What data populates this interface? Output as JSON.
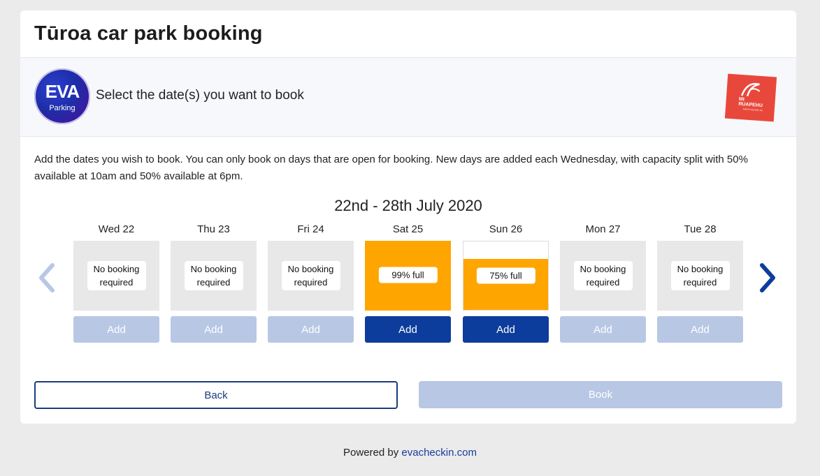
{
  "header": {
    "title": "Tūroa car park booking"
  },
  "select_band": {
    "logo_word": "EVA",
    "logo_sub": "Parking",
    "prompt": "Select the date(s) you want to book",
    "partner_logo_text_top": "Mt",
    "partner_logo_text_main": "RUAPEHU",
    "partner_logo_text_small": "NORTH ISLAND, NZ"
  },
  "intro": "Add the dates you wish to book. You can only book on days that are open for booking. New days are added each Wednesday, with capacity split with 50% available at 10am and 50% available at 6pm.",
  "week": {
    "label": "22nd - 28th July 2020",
    "prev_icon": "chevron-left-icon",
    "next_icon": "chevron-right-icon",
    "days": [
      {
        "name": "Wed 22",
        "status": "No booking required",
        "fill": 0,
        "add_label": "Add",
        "add_enabled": false
      },
      {
        "name": "Thu 23",
        "status": "No booking required",
        "fill": 0,
        "add_label": "Add",
        "add_enabled": false
      },
      {
        "name": "Fri 24",
        "status": "No booking required",
        "fill": 0,
        "add_label": "Add",
        "add_enabled": false
      },
      {
        "name": "Sat 25",
        "status": "99% full",
        "fill": 0.99,
        "add_label": "Add",
        "add_enabled": true
      },
      {
        "name": "Sun 26",
        "status": "75% full",
        "fill": 0.75,
        "add_label": "Add",
        "add_enabled": true
      },
      {
        "name": "Mon 27",
        "status": "No booking required",
        "fill": 0,
        "add_label": "Add",
        "add_enabled": false
      },
      {
        "name": "Tue 28",
        "status": "No booking required",
        "fill": 0,
        "add_label": "Add",
        "add_enabled": false
      }
    ]
  },
  "actions": {
    "back_label": "Back",
    "book_label": "Book"
  },
  "footer": {
    "prefix": "Powered by ",
    "link_text": "evacheckin.com"
  },
  "colors": {
    "fill": "#ffa500",
    "add_enabled": "#0d3d9c",
    "add_disabled": "#b8c7e4",
    "prev_arrow": "#b8c7e4",
    "next_arrow": "#0d3d9c"
  }
}
